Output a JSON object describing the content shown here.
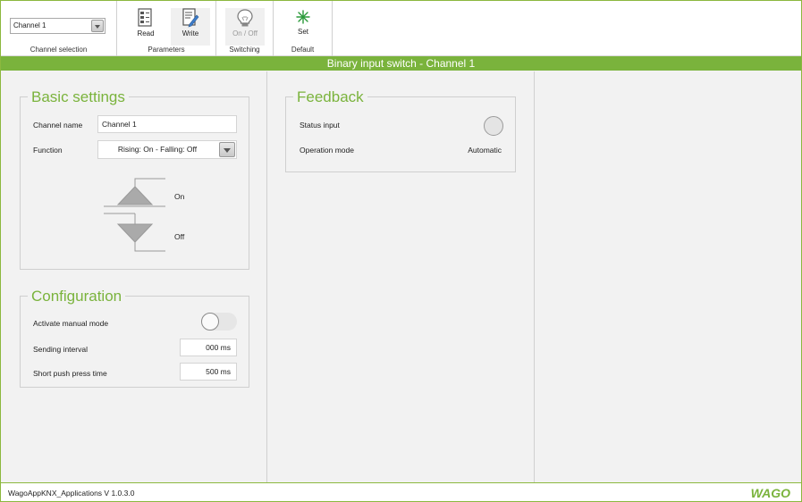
{
  "ribbon": {
    "channel_selection": {
      "value": "Channel 1",
      "caption": "Channel selection"
    },
    "parameters": {
      "caption": "Parameters",
      "read_label": "Read",
      "write_label": "Write"
    },
    "switching": {
      "caption": "Switching",
      "onoff_label": "On / Off"
    },
    "default": {
      "caption": "Default",
      "set_label": "Set"
    }
  },
  "titlebar": {
    "title": "Binary input switch - Channel 1"
  },
  "basic_settings": {
    "legend": "Basic settings",
    "channel_name_label": "Channel name",
    "channel_name_value": "Channel 1",
    "function_label": "Function",
    "function_value": "Rising: On - Falling: Off",
    "diagram_on_label": "On",
    "diagram_off_label": "Off"
  },
  "configuration": {
    "legend": "Configuration",
    "manual_mode_label": "Activate manual mode",
    "manual_mode_on": false,
    "sending_interval_label": "Sending interval",
    "sending_interval_value": "000 ms",
    "short_push_label": "Short push press time",
    "short_push_value": "500 ms"
  },
  "feedback": {
    "legend": "Feedback",
    "status_input_label": "Status input",
    "operation_mode_label": "Operation mode",
    "operation_mode_value": "Automatic"
  },
  "statusbar": {
    "version": "WagoAppKNX_Applications V 1.0.3.0",
    "logo": "WAGO"
  },
  "colors": {
    "accent": "#7ab33c",
    "border": "#cfcfcf",
    "panel": "#f2f2f2"
  },
  "icons": [
    "read-parameters-icon",
    "write-parameters-icon",
    "lightbulb-icon",
    "set-default-icon",
    "dropdown-arrow-icon"
  ]
}
